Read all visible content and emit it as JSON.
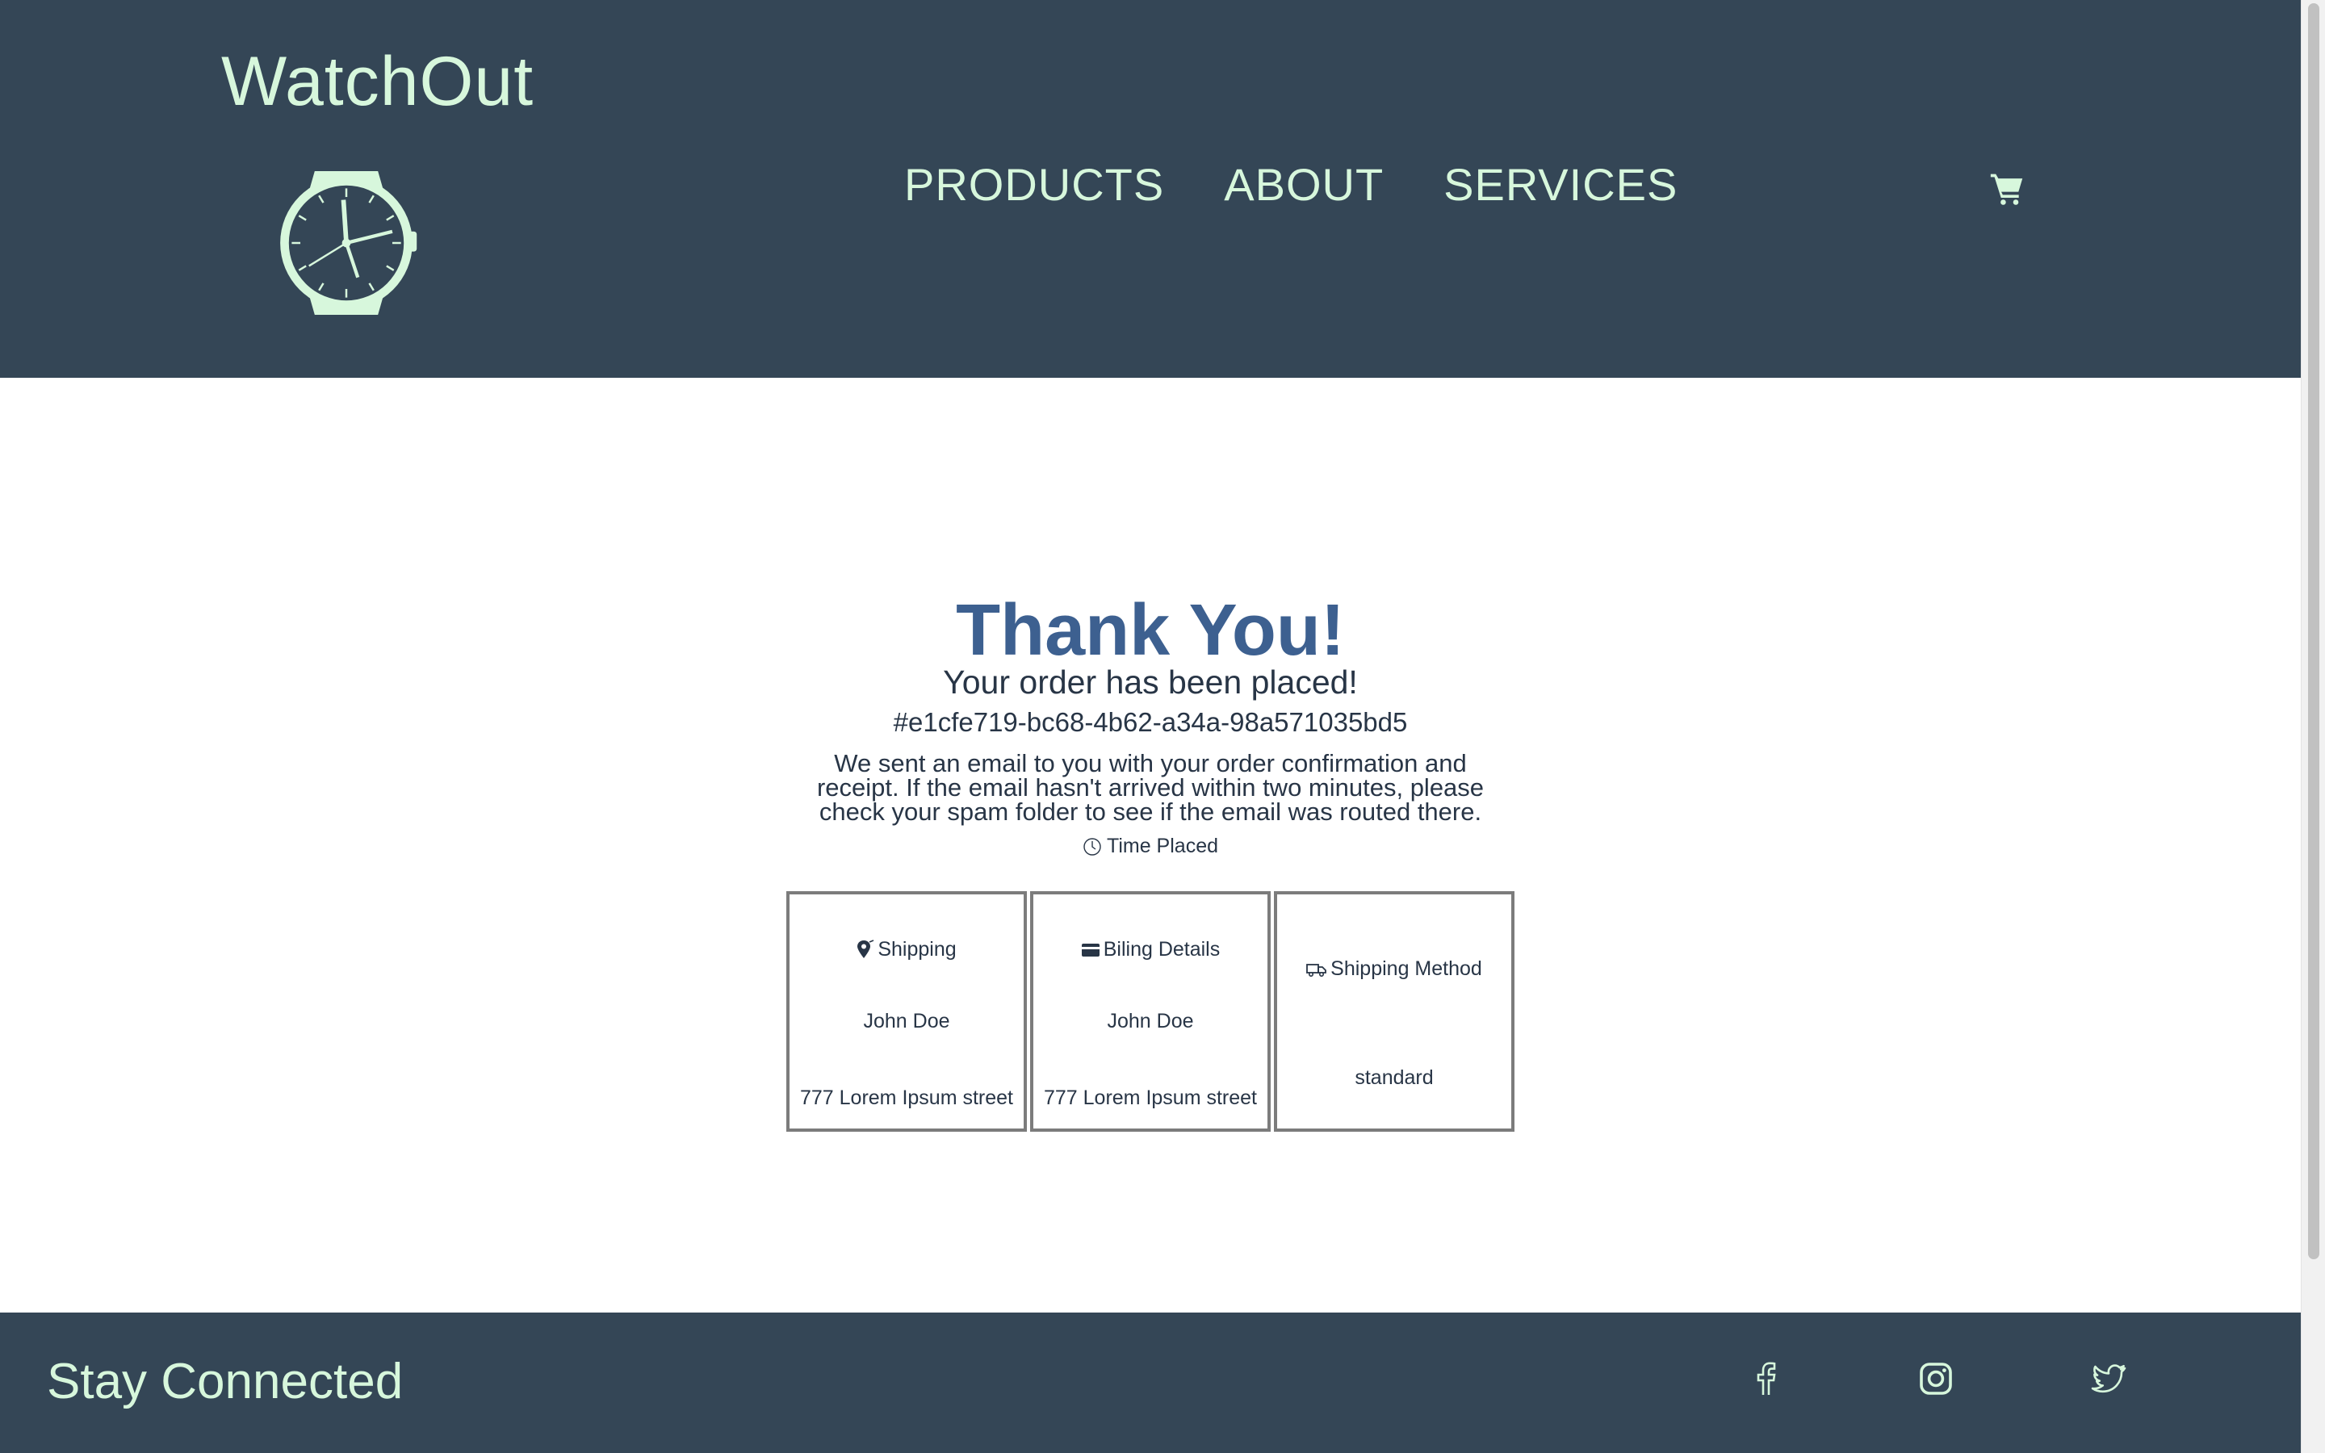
{
  "header": {
    "brand": "WatchOut",
    "logo_icon": "wristwatch-icon",
    "nav": [
      "PRODUCTS",
      "ABOUT",
      "SERVICES"
    ],
    "cart_icon": "shopping-cart-icon"
  },
  "confirmation": {
    "heading": "Thank You!",
    "subheading": "Your order has been placed!",
    "order_id": "#e1cfe719-bc68-4b62-a34a-98a571035bd5",
    "message": "We sent an email to you with your order confirmation and receipt. If the email hasn't arrived within two minutes, please check your spam folder to see if the email was routed there.",
    "time_label": "Time Placed",
    "time_icon": "clock-icon"
  },
  "cards": [
    {
      "icon": "map-pin-icon",
      "title": "Shipping",
      "line1": "John Doe",
      "line2": "777 Lorem Ipsum street"
    },
    {
      "icon": "credit-card-icon",
      "title": "Biling Details",
      "line1": "John Doe",
      "line2": "777 Lorem Ipsum street"
    },
    {
      "icon": "truck-icon",
      "title": "Shipping Method",
      "line1": "standard"
    }
  ],
  "footer": {
    "title": "Stay Connected",
    "social": [
      "facebook-icon",
      "instagram-icon",
      "twitter-icon"
    ]
  },
  "colors": {
    "header_bg": "#344656",
    "accent_text": "#d7f7dc",
    "heading": "#3d6090",
    "body_text": "#283546"
  }
}
